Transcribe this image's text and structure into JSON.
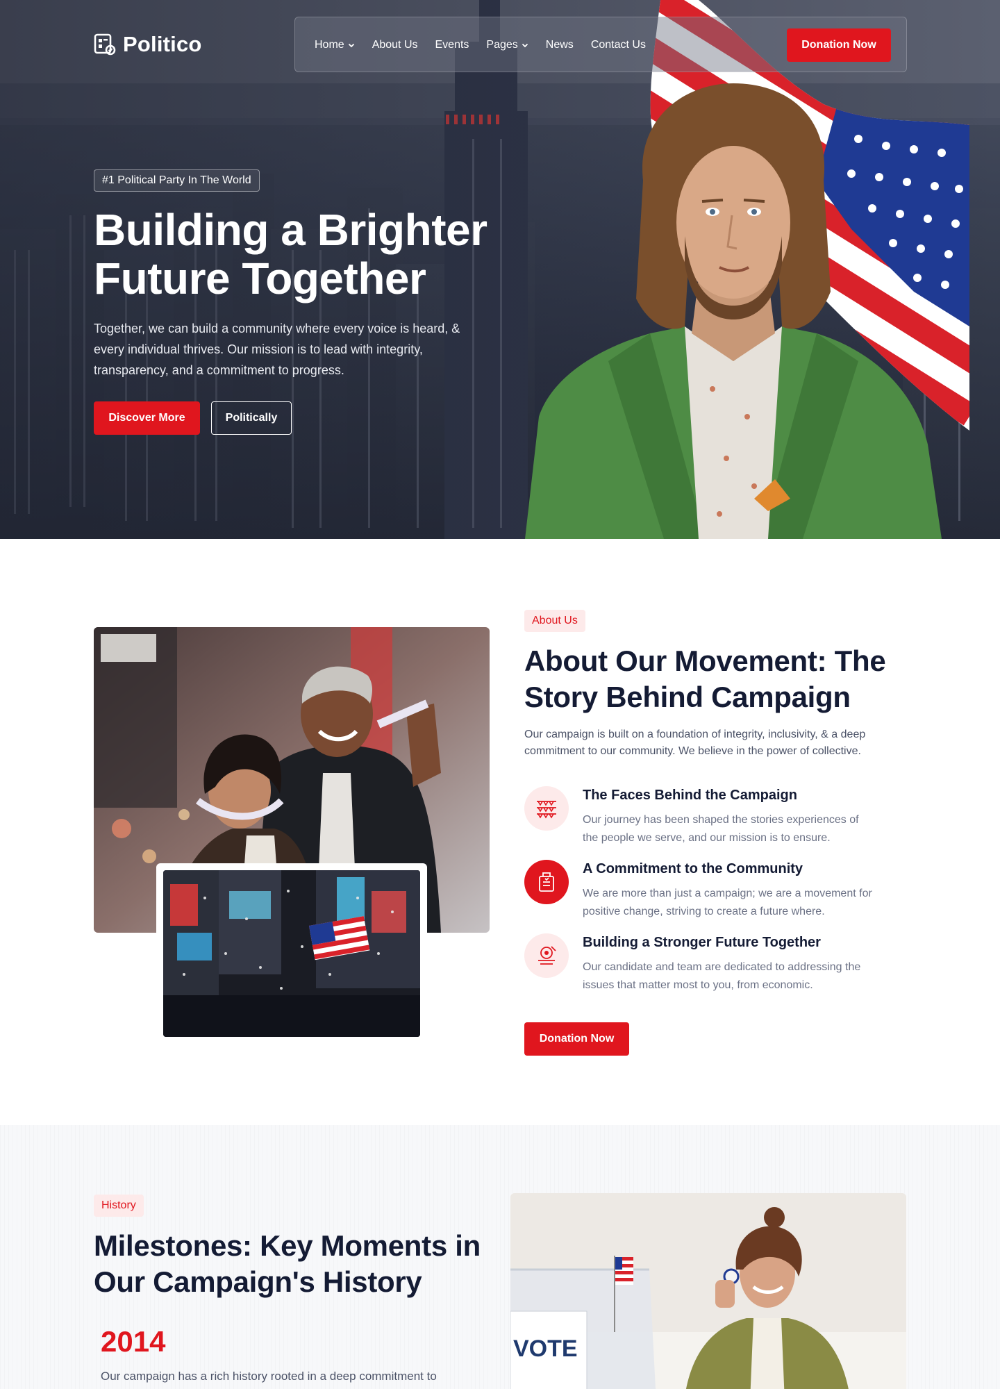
{
  "brand": {
    "name": "Politico"
  },
  "nav": {
    "items": [
      {
        "label": "Home",
        "has_dropdown": true
      },
      {
        "label": "About Us",
        "has_dropdown": false
      },
      {
        "label": "Events",
        "has_dropdown": false
      },
      {
        "label": "Pages",
        "has_dropdown": true
      },
      {
        "label": "News",
        "has_dropdown": false
      },
      {
        "label": "Contact Us",
        "has_dropdown": false
      }
    ],
    "cta_label": "Donation Now"
  },
  "hero": {
    "badge": "#1 Political Party In The World",
    "title_line1": "Building a Brighter",
    "title_line2": "Future Together",
    "description": "Together, we can build a community where every voice is heard, & every individual thrives. Our mission is to lead with integrity, transparency, and a commitment to progress.",
    "primary_button": "Discover More",
    "secondary_button": "Politically"
  },
  "about": {
    "tag": "About Us",
    "title_line1": "About Our Movement: The",
    "title_line2": "Story Behind Campaign",
    "description": "Our campaign is built on a foundation of integrity, inclusivity, & a deep commitment to our community. We believe in the power of collective.",
    "features": [
      {
        "title": "The Faces Behind the Campaign",
        "description": "Our journey has been shaped the stories experiences of the people we serve, and our mission is to ensure.",
        "icon": "bunting-icon"
      },
      {
        "title": "A Commitment to the Community",
        "description": "We are more than just a campaign; we are a movement for positive change, striving to create a future where.",
        "icon": "ballot-box-icon"
      },
      {
        "title": "Building a Stronger Future Together",
        "description": "Our candidate and team are dedicated to addressing the issues that matter most to you, from economic.",
        "icon": "podium-icon"
      }
    ],
    "cta_label": "Donation Now"
  },
  "history": {
    "tag": "History",
    "title_line1": "Milestones: Key Moments in",
    "title_line2": "Our Campaign's History",
    "year": "2014",
    "description": "Our campaign has a rich history rooted in a deep commitment to",
    "vote_sign": "VOTE"
  },
  "colors": {
    "accent": "#e0161e",
    "heading": "#141b34",
    "body_text": "#4a5166",
    "tag_bg": "#fdeaea"
  }
}
